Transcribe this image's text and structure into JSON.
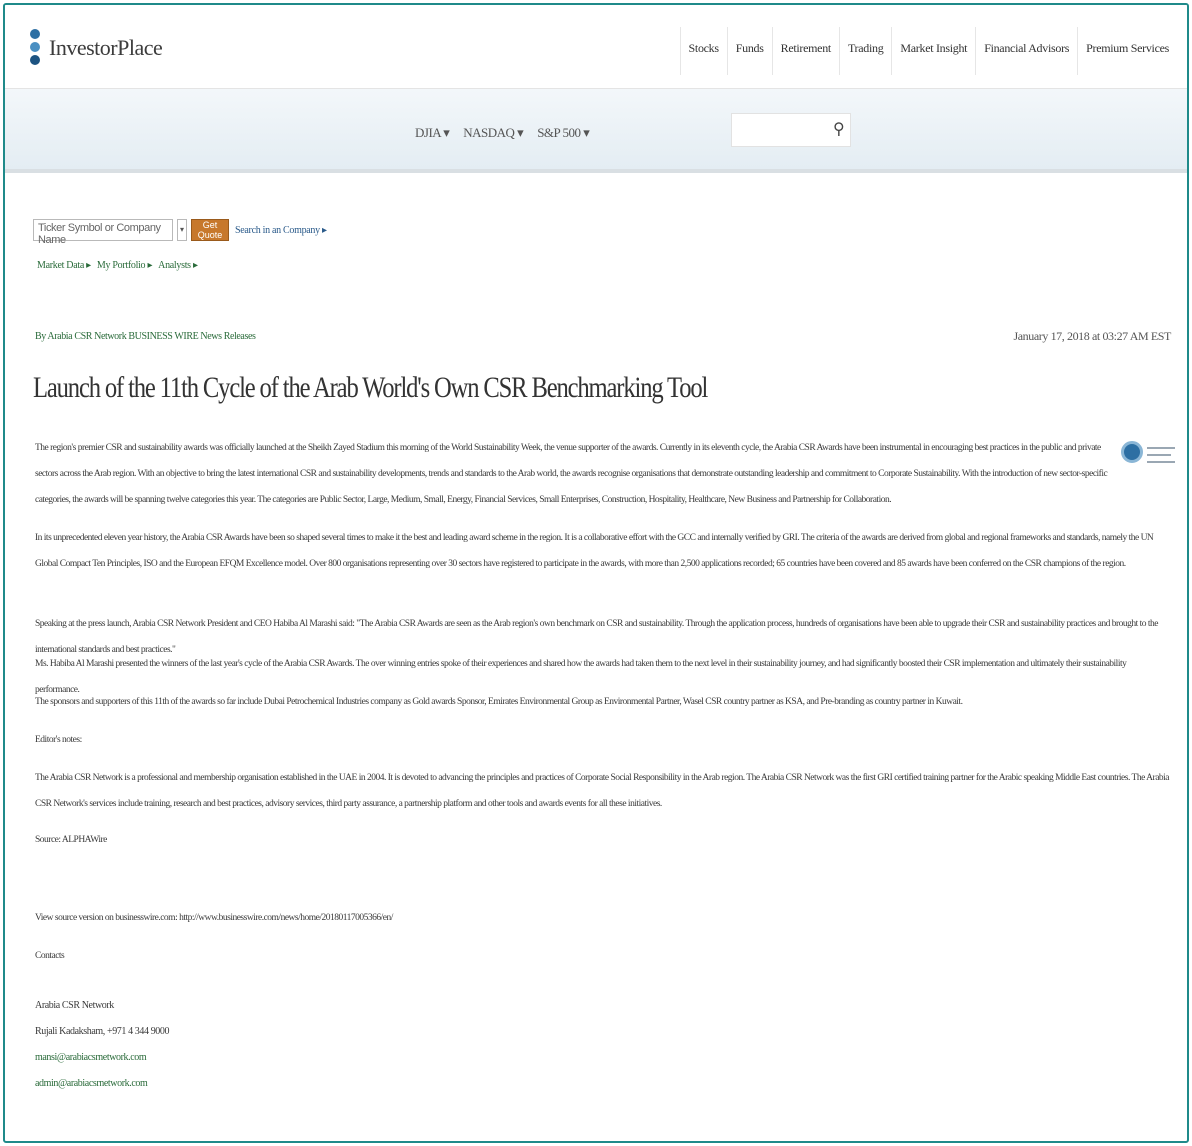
{
  "header": {
    "logo_text": "InvestorPlace",
    "nav": [
      "Stocks",
      "Funds",
      "Retirement",
      "Trading",
      "Market Insight",
      "Financial Advisors",
      "Premium Services"
    ]
  },
  "market": {
    "indices": [
      "DJIA",
      "NASDAQ",
      "S&P 500"
    ]
  },
  "quote": {
    "placeholder": "Ticker Symbol or Company Name",
    "button_label": "Get Quote",
    "link": "Search in an Company",
    "sub_links": [
      "Market Data",
      "My Portfolio",
      "Analysts"
    ]
  },
  "article": {
    "byline": "By Arabia CSR Network BUSINESS WIRE News Releases",
    "date": "January 17, 2018 at 03:27 AM EST",
    "headline": "Launch of the 11th Cycle of the Arab World's Own CSR Benchmarking Tool",
    "p1": "The region's premier CSR and sustainability awards was officially launched at the Sheikh Zayed Stadium this morning of the World Sustainability Week, the venue supporter of the awards. Currently in its eleventh cycle, the Arabia CSR Awards have been instrumental in encouraging best practices in the public and private sectors across the Arab region. With an objective to bring the latest international CSR and sustainability developments, trends and standards to the Arab world, the awards recognise organisations that demonstrate outstanding leadership and commitment to Corporate Sustainability. With the introduction of new sector-specific categories, the awards will be spanning twelve categories this year. The categories are Public Sector, Large, Medium, Small, Energy, Financial Services, Small Enterprises, Construction, Hospitality, Healthcare, New Business and Partnership for Collaboration.",
    "p1_link": "Arabia CSR Awards",
    "p2": "In its unprecedented eleven year history, the Arabia CSR Awards have been so shaped several times to make it the best and leading award scheme in the region. It is a collaborative effort with the GCC and internally verified by GRI. The criteria of the awards are derived from global and regional frameworks and standards, namely the UN Global Compact Ten Principles, ISO and the European EFQM Excellence model. Over 800 organisations representing over 30 sectors have registered to participate in the awards, with more than 2,500 applications recorded; 65 countries have been covered and 85 awards have been conferred on the CSR champions of the region.",
    "p3": "Speaking at the press launch, Arabia CSR Network President and CEO Habiba Al Marashi said: \"The Arabia CSR Awards are seen as the Arab region's own benchmark on CSR and sustainability. Through the application process, hundreds of organisations have been able to upgrade their CSR and sustainability practices and brought to the international standards and best practices.\"",
    "p3_link": "Arabia CSR Network President and CEO Habiba Al Marashi",
    "p4": "Ms. Habiba Al Marashi presented the winners of the last year's cycle of the Arabia CSR Awards. The over winning entries spoke of their experiences and shared how the awards had taken them to the next level in their sustainability journey, and had significantly boosted their CSR implementation and ultimately their sustainability performance.",
    "p5": "The sponsors and supporters of this 11th of the awards so far include Dubai Petrochemical Industries company as Gold awards Sponsor, Emirates Environmental Group as Environmental Partner, Wasel CSR country partner as KSA, and Pre-branding as country partner in Kuwait.",
    "p6": "Editor's notes:",
    "p7": "The Arabia CSR Network is a professional and membership organisation established in the UAE in 2004. It is devoted to advancing the principles and practices of Corporate Social Responsibility in the Arab region. The Arabia CSR Network was the first GRI certified training partner for the Arabic speaking Middle East countries. The Arabia CSR Network's services include training, research and best practices, advisory services, third party assurance, a partnership platform and other tools and awards events for all these initiatives.",
    "p8": "Source: ALPHAWire",
    "p9": "View source version on businesswire.com: http://www.businesswire.com/news/home/20180117005366/en/",
    "p9_link": "http://www.businesswire.com/news/home/20180117005366/en/",
    "p10": "Contacts",
    "contacts": [
      "Arabia CSR Network",
      "Rujali Kadaksham, +971 4 344 9000",
      "mansi@arabiacsrnetwork.com",
      "admin@arabiacsrnetwork.com"
    ]
  }
}
